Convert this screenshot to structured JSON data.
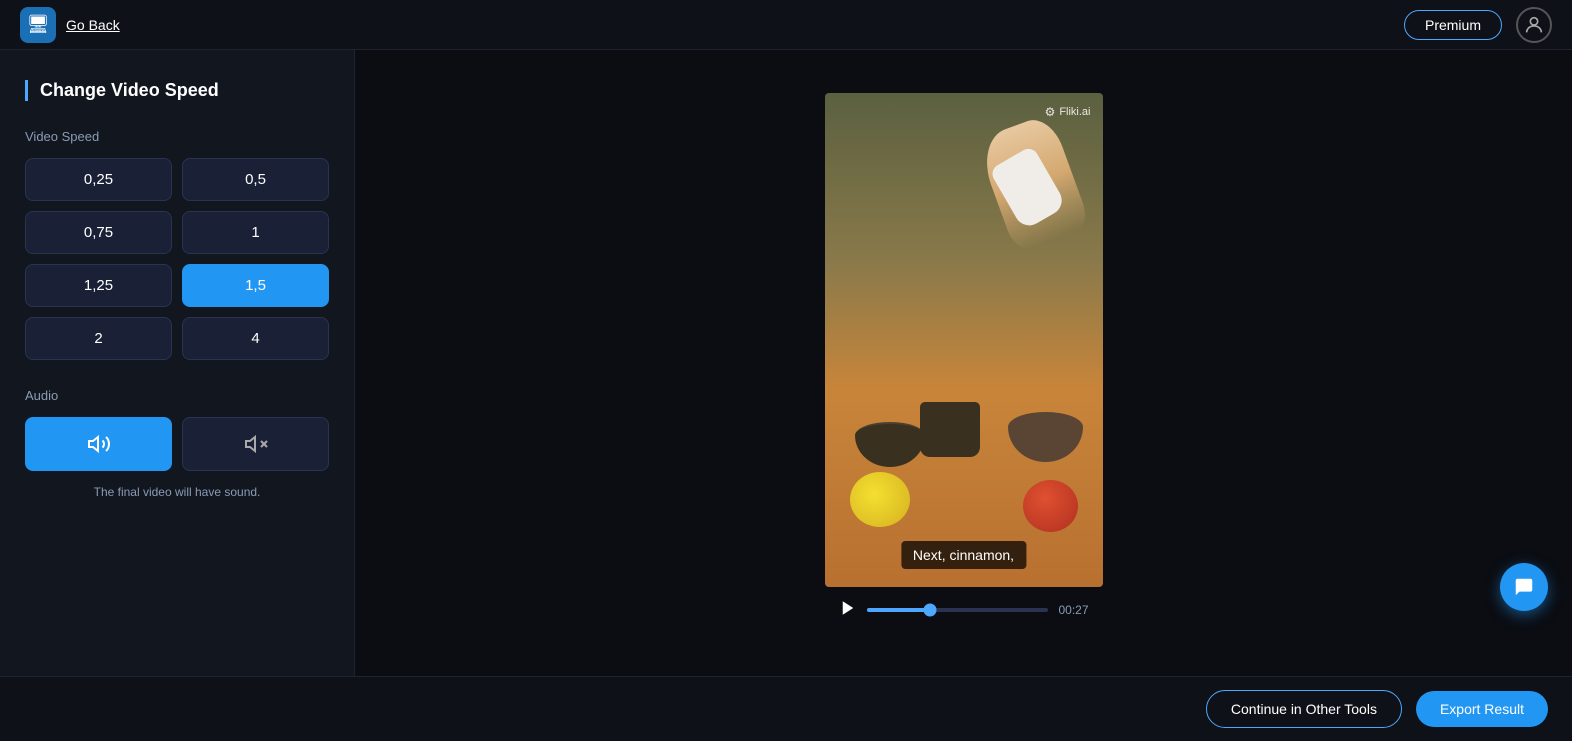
{
  "header": {
    "app_icon": "🖥",
    "go_back": "Go Back",
    "premium_label": "Premium",
    "user_icon": "person"
  },
  "sidebar": {
    "title": "Change Video Speed",
    "video_speed_label": "Video Speed",
    "speed_options": [
      {
        "value": "0,25",
        "active": false
      },
      {
        "value": "0,5",
        "active": false
      },
      {
        "value": "0,75",
        "active": false
      },
      {
        "value": "1",
        "active": false
      },
      {
        "value": "1,25",
        "active": false
      },
      {
        "value": "1,5",
        "active": true
      },
      {
        "value": "2",
        "active": false
      },
      {
        "value": "4",
        "active": false
      }
    ],
    "audio_label": "Audio",
    "audio_note": "The final video will have sound."
  },
  "video": {
    "watermark": "Fliki.ai",
    "subtitle": "Next, cinnamon,",
    "time_current": "00:27",
    "progress_percent": 35
  },
  "footer": {
    "continue_label": "Continue in Other Tools",
    "export_label": "Export Result"
  },
  "chat": {
    "icon": "💬"
  }
}
